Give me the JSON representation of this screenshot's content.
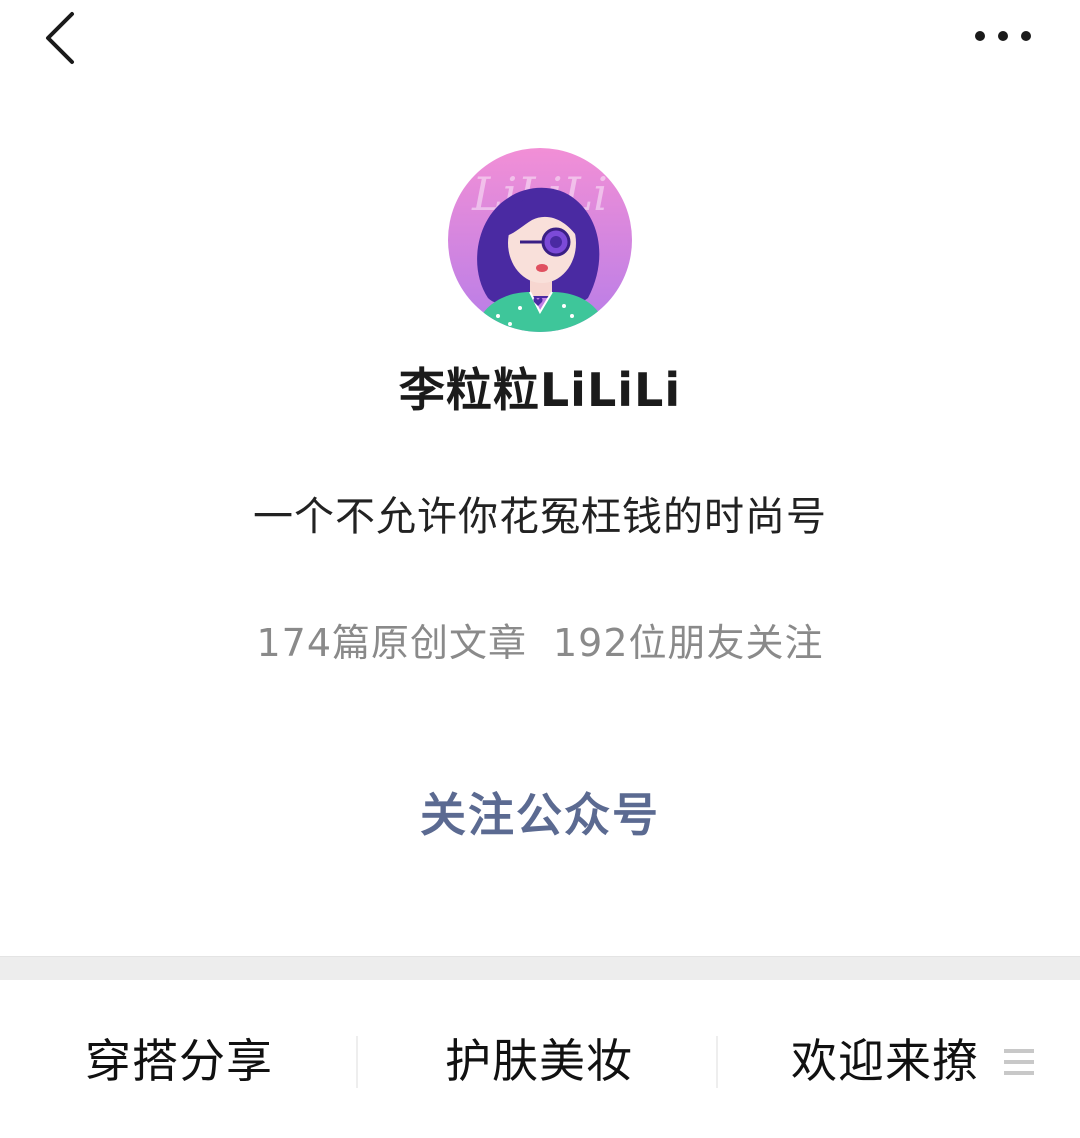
{
  "nav": {
    "back_icon": "chevron-left-icon",
    "more_icon": "more-dots-icon"
  },
  "profile": {
    "avatar_text": "LiLiLi",
    "name": "李粒粒LiLiLi",
    "bio": "一个不允许你花冤枉钱的时尚号",
    "articles": "174篇原创文章",
    "followers": "192位朋友关注"
  },
  "actions": {
    "follow_label": "关注公众号"
  },
  "menu": {
    "items": [
      {
        "label": "穿搭分享"
      },
      {
        "label": "护肤美妆"
      },
      {
        "label": "欢迎来撩"
      }
    ],
    "submenu_icon": "list-menu-icon"
  },
  "colors": {
    "accent": "#5b6a91",
    "avatar_bg_top": "#f08ad8",
    "avatar_bg_bottom": "#b67ae6",
    "hair": "#4a2aa2",
    "shirt": "#3ec69a",
    "stats_text": "#8a8a8a",
    "band": "#ededed"
  }
}
